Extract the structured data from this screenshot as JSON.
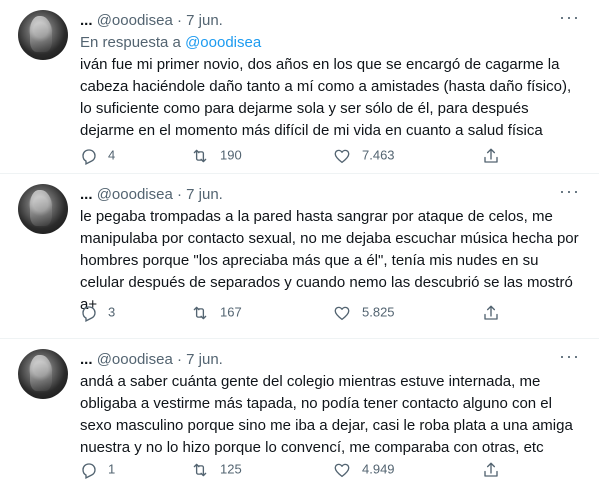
{
  "tweets": [
    {
      "name": "...",
      "handle": "@ooodisea",
      "separator": "·",
      "date": "7 jun.",
      "more_icon": "more-icon",
      "reply_to_prefix": "En respuesta a",
      "reply_to_handle": "@ooodisea",
      "text": "iván fue mi primer novio, dos años en los que se encargó de cagarme la cabeza haciéndole daño tanto a mí como a amistades (hasta daño físico), lo suficiente como para dejarme sola y ser sólo de él, para después dejarme en el momento más difícil de mi vida en cuanto a salud física",
      "replies": "4",
      "retweets": "190",
      "likes": "7.463"
    },
    {
      "name": "...",
      "handle": "@ooodisea",
      "separator": "·",
      "date": "7 jun.",
      "text": "le pegaba trompadas a la pared hasta sangrar por ataque de celos, me manipulaba por contacto sexual, no me dejaba escuchar música hecha por hombres porque \"los apreciaba más que a él\", tenía mis nudes en su celular después de separados y cuando nemo las descubrió se las mostró a+",
      "replies": "3",
      "retweets": "167",
      "likes": "5.825"
    },
    {
      "name": "...",
      "handle": "@ooodisea",
      "separator": "·",
      "date": "7 jun.",
      "text": "andá a saber cuánta gente del colegio mientras estuve internada, me obligaba a vestirme más tapada, no podía tener contacto alguno con el sexo masculino porque sino me iba a dejar, casi le roba plata a una amiga nuestra y no lo hizo porque lo convencí, me comparaba con otras, etc",
      "replies": "1",
      "retweets": "125",
      "likes": "4.949"
    }
  ],
  "icons": {
    "reply": "reply-icon",
    "retweet": "retweet-icon",
    "like": "heart-icon",
    "share": "share-icon"
  },
  "colors": {
    "text": "#0f1419",
    "secondary": "#536471",
    "link": "#1d9bf0",
    "divider": "#eff3f4"
  }
}
